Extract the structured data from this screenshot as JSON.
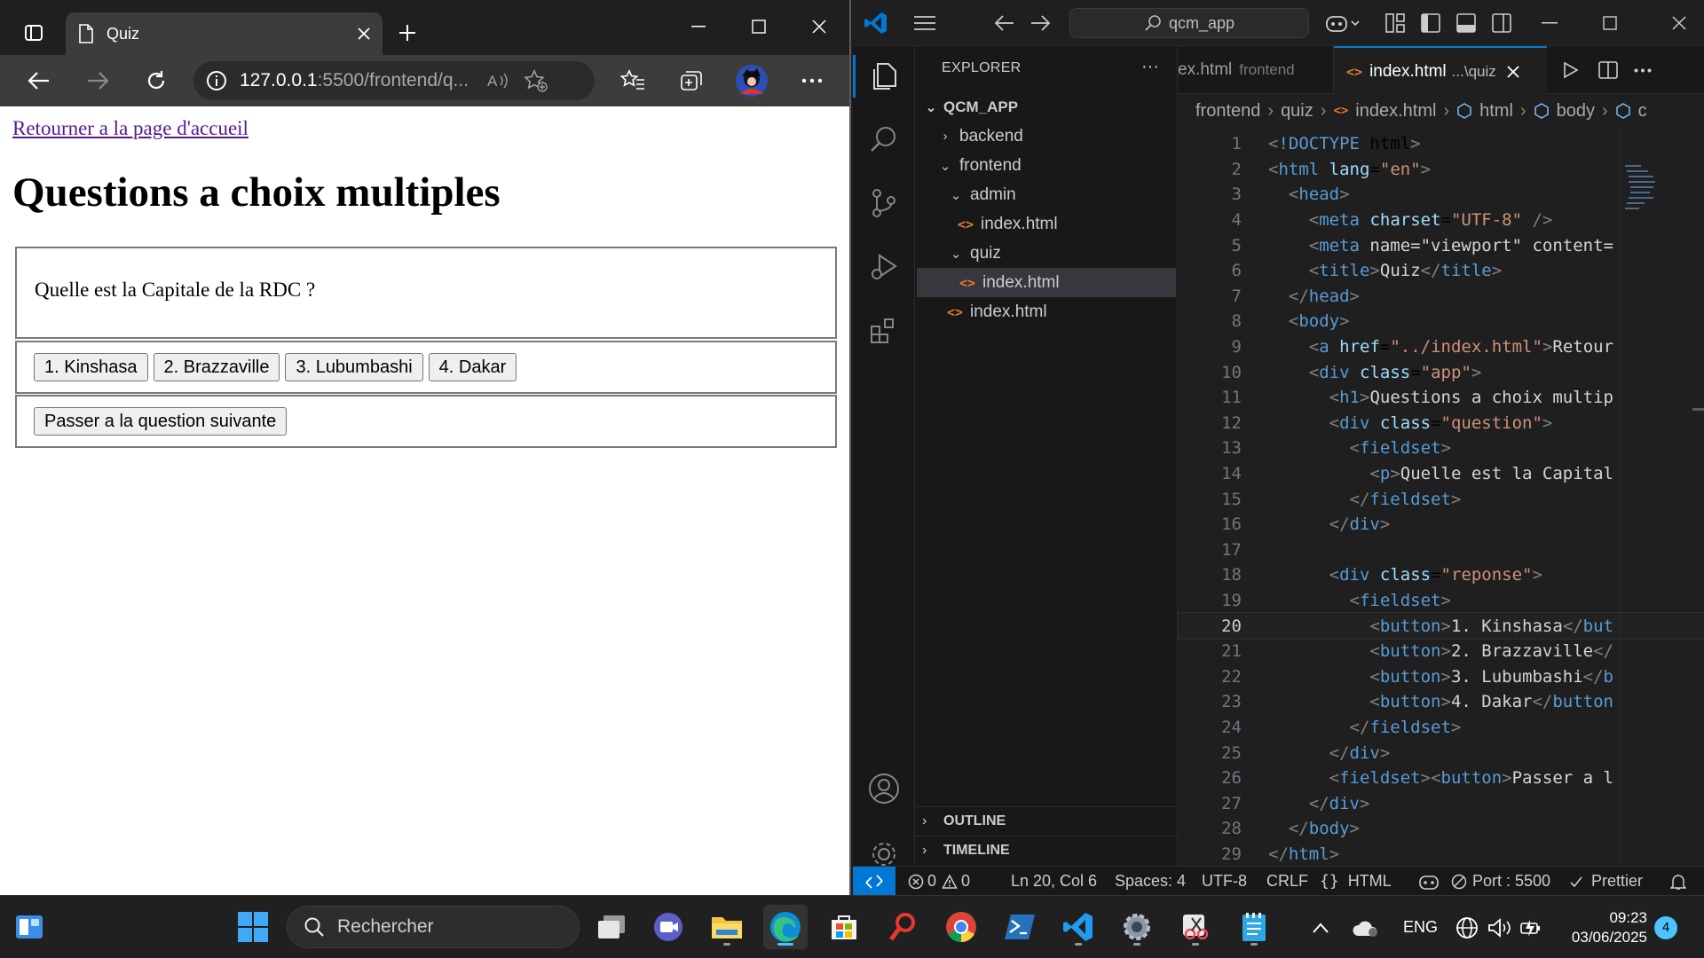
{
  "browser": {
    "tab_title": "Quiz",
    "url_host": "127.0.0.1",
    "url_path": ":5500/frontend/q...",
    "page": {
      "home_link": "Retourner a la page d'accueil",
      "title": "Questions a choix multiples",
      "question": "Quelle est la Capitale de la RDC ?",
      "answers": [
        "1. Kinshasa",
        "2. Brazzaville",
        "3. Lubumbashi",
        "4. Dakar"
      ],
      "next_button": "Passer a la question suivante"
    }
  },
  "vscode": {
    "search_text": "qcm_app",
    "explorer_label": "EXPLORER",
    "more_label": "···",
    "project": "QCM_APP",
    "tree": {
      "backend": "backend",
      "frontend": "frontend",
      "admin": "admin",
      "admin_index": "index.html",
      "quiz": "quiz",
      "quiz_index": "index.html",
      "root_index": "index.html"
    },
    "outline": "OUTLINE",
    "timeline": "TIMELINE",
    "tabs": {
      "inactive_name": "ex.html",
      "inactive_hint": "frontend",
      "active_name": "index.html",
      "active_hint": "...\\quiz"
    },
    "breadcrumbs": [
      "frontend",
      "quiz",
      "index.html",
      "html",
      "body",
      "c"
    ],
    "current_line": 20,
    "code": [
      {
        "n": "1",
        "s": "<!DOCTYPE html>"
      },
      {
        "n": "2",
        "s": "<html lang=\"en\">"
      },
      {
        "n": "3",
        "s": "  <head>"
      },
      {
        "n": "4",
        "s": "    <meta charset=\"UTF-8\" />"
      },
      {
        "n": "5",
        "s": "    <meta name=\"viewport\" content="
      },
      {
        "n": "6",
        "s": "    <title>Quiz</title>"
      },
      {
        "n": "7",
        "s": "  </head>"
      },
      {
        "n": "8",
        "s": "  <body>"
      },
      {
        "n": "9",
        "s": "    <a href=\"../index.html\">Retour"
      },
      {
        "n": "10",
        "s": "    <div class=\"app\">"
      },
      {
        "n": "11",
        "s": "      <h1>Questions a choix multip"
      },
      {
        "n": "12",
        "s": "      <div class=\"question\">"
      },
      {
        "n": "13",
        "s": "        <fieldset>"
      },
      {
        "n": "14",
        "s": "          <p>Quelle est la Capital"
      },
      {
        "n": "15",
        "s": "        </fieldset>"
      },
      {
        "n": "16",
        "s": "      </div>"
      },
      {
        "n": "17",
        "s": ""
      },
      {
        "n": "18",
        "s": "      <div class=\"reponse\">"
      },
      {
        "n": "19",
        "s": "        <fieldset>"
      },
      {
        "n": "20",
        "s": "          <button>1. Kinshasa</but"
      },
      {
        "n": "21",
        "s": "          <button>2. Brazzaville</"
      },
      {
        "n": "22",
        "s": "          <button>3. Lubumbashi</b"
      },
      {
        "n": "23",
        "s": "          <button>4. Dakar</button"
      },
      {
        "n": "24",
        "s": "        </fieldset>"
      },
      {
        "n": "25",
        "s": "      </div>"
      },
      {
        "n": "26",
        "s": "      <fieldset><button>Passer a l"
      },
      {
        "n": "27",
        "s": "    </div>"
      },
      {
        "n": "28",
        "s": "  </body>"
      },
      {
        "n": "29",
        "s": "</html>"
      }
    ],
    "status": {
      "errors": "0",
      "warnings": "0",
      "position": "Ln 20, Col 6",
      "spaces": "Spaces: 4",
      "encoding": "UTF-8",
      "eol": "CRLF",
      "language": "HTML",
      "port": "Port : 5500",
      "prettier": "Prettier"
    }
  },
  "taskbar": {
    "search_placeholder": "Rechercher",
    "lang": "ENG",
    "time": "09:23",
    "date": "03/06/2025",
    "notifications": "4"
  },
  "colors": {
    "vscode_accent": "#0078d4",
    "html_icon": "#e37933",
    "link_visited": "#551a8b"
  }
}
